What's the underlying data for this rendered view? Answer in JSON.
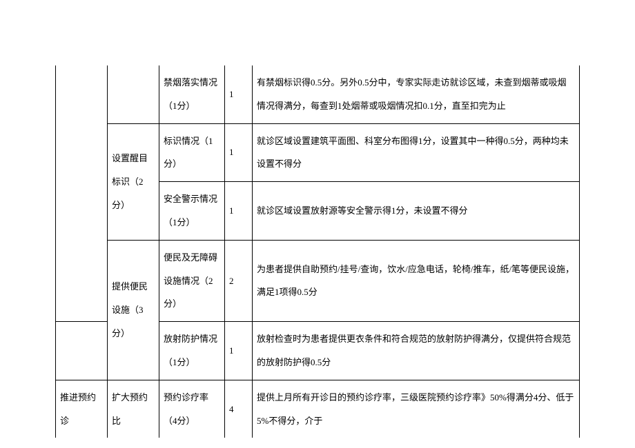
{
  "rows": [
    {
      "sub": "禁烟落实情况（1分）",
      "score": "1",
      "desc": "有禁烟标识得0.5分。另外0.5分中，专家实际走访就诊区域，未查到烟蒂或吸烟情况得满分，每查到1处烟蒂或吸烟情况扣0.1分，直至扣完为止"
    },
    {
      "cat": "设置醒目标识（2分）",
      "sub1": "标识情况（1分）",
      "score1": "1",
      "desc1": "就诊区域设置建筑平面图、科室分布图得1分，设置其中一种得0.5分，两种均未设置不得分",
      "sub2": "安全警示情况（1分）",
      "score2": "1",
      "desc2": "就诊区域设置放射源等安全警示得1分，未设置不得分"
    },
    {
      "cat": "提供便民设施（3分）",
      "sub1": "便民及无障碍设施情况（2分）",
      "score1": "2",
      "desc1": "为患者提供自助预约/挂号/查询，饮水/应急电话，轮椅/推车，纸/笔等便民设施，满足1项得0.5分",
      "sub2": "放射防护情况（1分）",
      "score2": "1",
      "desc2": "放射检查时为患者提供更衣条件和符合规范的放射防护得满分，仅提供符合规范的放射防护得0.5分"
    },
    {
      "main": "推进预约诊",
      "cat": "扩大预约比",
      "sub": "预约诊疗率（4分）",
      "score": "4",
      "desc": "提供上月所有开诊日的预约诊疗率，三级医院预约诊疗率》50%得满分4分、低于5%不得分，介于"
    }
  ]
}
